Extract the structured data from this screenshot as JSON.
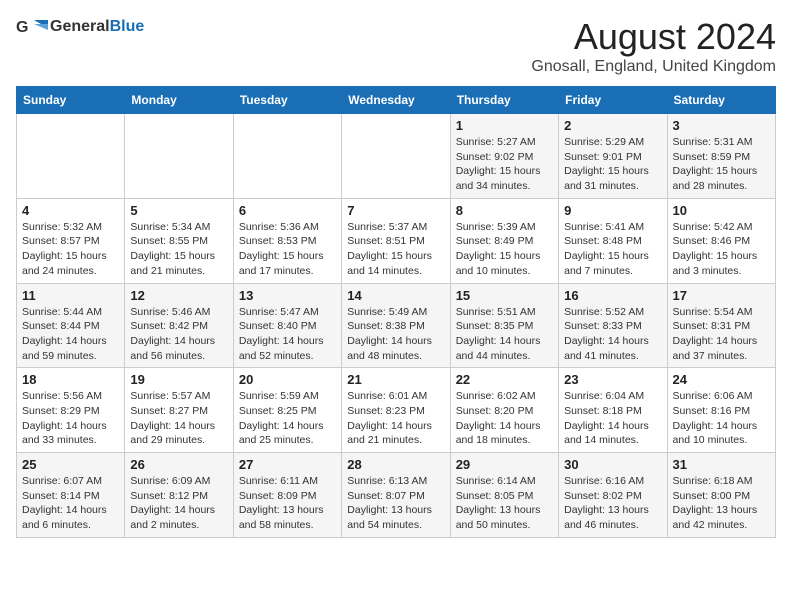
{
  "logo": {
    "text_general": "General",
    "text_blue": "Blue"
  },
  "title": "August 2024",
  "subtitle": "Gnosall, England, United Kingdom",
  "days_of_week": [
    "Sunday",
    "Monday",
    "Tuesday",
    "Wednesday",
    "Thursday",
    "Friday",
    "Saturday"
  ],
  "weeks": [
    [
      {
        "day": "",
        "info": ""
      },
      {
        "day": "",
        "info": ""
      },
      {
        "day": "",
        "info": ""
      },
      {
        "day": "",
        "info": ""
      },
      {
        "day": "1",
        "info": "Sunrise: 5:27 AM\nSunset: 9:02 PM\nDaylight: 15 hours\nand 34 minutes."
      },
      {
        "day": "2",
        "info": "Sunrise: 5:29 AM\nSunset: 9:01 PM\nDaylight: 15 hours\nand 31 minutes."
      },
      {
        "day": "3",
        "info": "Sunrise: 5:31 AM\nSunset: 8:59 PM\nDaylight: 15 hours\nand 28 minutes."
      }
    ],
    [
      {
        "day": "4",
        "info": "Sunrise: 5:32 AM\nSunset: 8:57 PM\nDaylight: 15 hours\nand 24 minutes."
      },
      {
        "day": "5",
        "info": "Sunrise: 5:34 AM\nSunset: 8:55 PM\nDaylight: 15 hours\nand 21 minutes."
      },
      {
        "day": "6",
        "info": "Sunrise: 5:36 AM\nSunset: 8:53 PM\nDaylight: 15 hours\nand 17 minutes."
      },
      {
        "day": "7",
        "info": "Sunrise: 5:37 AM\nSunset: 8:51 PM\nDaylight: 15 hours\nand 14 minutes."
      },
      {
        "day": "8",
        "info": "Sunrise: 5:39 AM\nSunset: 8:49 PM\nDaylight: 15 hours\nand 10 minutes."
      },
      {
        "day": "9",
        "info": "Sunrise: 5:41 AM\nSunset: 8:48 PM\nDaylight: 15 hours\nand 7 minutes."
      },
      {
        "day": "10",
        "info": "Sunrise: 5:42 AM\nSunset: 8:46 PM\nDaylight: 15 hours\nand 3 minutes."
      }
    ],
    [
      {
        "day": "11",
        "info": "Sunrise: 5:44 AM\nSunset: 8:44 PM\nDaylight: 14 hours\nand 59 minutes."
      },
      {
        "day": "12",
        "info": "Sunrise: 5:46 AM\nSunset: 8:42 PM\nDaylight: 14 hours\nand 56 minutes."
      },
      {
        "day": "13",
        "info": "Sunrise: 5:47 AM\nSunset: 8:40 PM\nDaylight: 14 hours\nand 52 minutes."
      },
      {
        "day": "14",
        "info": "Sunrise: 5:49 AM\nSunset: 8:38 PM\nDaylight: 14 hours\nand 48 minutes."
      },
      {
        "day": "15",
        "info": "Sunrise: 5:51 AM\nSunset: 8:35 PM\nDaylight: 14 hours\nand 44 minutes."
      },
      {
        "day": "16",
        "info": "Sunrise: 5:52 AM\nSunset: 8:33 PM\nDaylight: 14 hours\nand 41 minutes."
      },
      {
        "day": "17",
        "info": "Sunrise: 5:54 AM\nSunset: 8:31 PM\nDaylight: 14 hours\nand 37 minutes."
      }
    ],
    [
      {
        "day": "18",
        "info": "Sunrise: 5:56 AM\nSunset: 8:29 PM\nDaylight: 14 hours\nand 33 minutes."
      },
      {
        "day": "19",
        "info": "Sunrise: 5:57 AM\nSunset: 8:27 PM\nDaylight: 14 hours\nand 29 minutes."
      },
      {
        "day": "20",
        "info": "Sunrise: 5:59 AM\nSunset: 8:25 PM\nDaylight: 14 hours\nand 25 minutes."
      },
      {
        "day": "21",
        "info": "Sunrise: 6:01 AM\nSunset: 8:23 PM\nDaylight: 14 hours\nand 21 minutes."
      },
      {
        "day": "22",
        "info": "Sunrise: 6:02 AM\nSunset: 8:20 PM\nDaylight: 14 hours\nand 18 minutes."
      },
      {
        "day": "23",
        "info": "Sunrise: 6:04 AM\nSunset: 8:18 PM\nDaylight: 14 hours\nand 14 minutes."
      },
      {
        "day": "24",
        "info": "Sunrise: 6:06 AM\nSunset: 8:16 PM\nDaylight: 14 hours\nand 10 minutes."
      }
    ],
    [
      {
        "day": "25",
        "info": "Sunrise: 6:07 AM\nSunset: 8:14 PM\nDaylight: 14 hours\nand 6 minutes."
      },
      {
        "day": "26",
        "info": "Sunrise: 6:09 AM\nSunset: 8:12 PM\nDaylight: 14 hours\nand 2 minutes."
      },
      {
        "day": "27",
        "info": "Sunrise: 6:11 AM\nSunset: 8:09 PM\nDaylight: 13 hours\nand 58 minutes."
      },
      {
        "day": "28",
        "info": "Sunrise: 6:13 AM\nSunset: 8:07 PM\nDaylight: 13 hours\nand 54 minutes."
      },
      {
        "day": "29",
        "info": "Sunrise: 6:14 AM\nSunset: 8:05 PM\nDaylight: 13 hours\nand 50 minutes."
      },
      {
        "day": "30",
        "info": "Sunrise: 6:16 AM\nSunset: 8:02 PM\nDaylight: 13 hours\nand 46 minutes."
      },
      {
        "day": "31",
        "info": "Sunrise: 6:18 AM\nSunset: 8:00 PM\nDaylight: 13 hours\nand 42 minutes."
      }
    ]
  ]
}
